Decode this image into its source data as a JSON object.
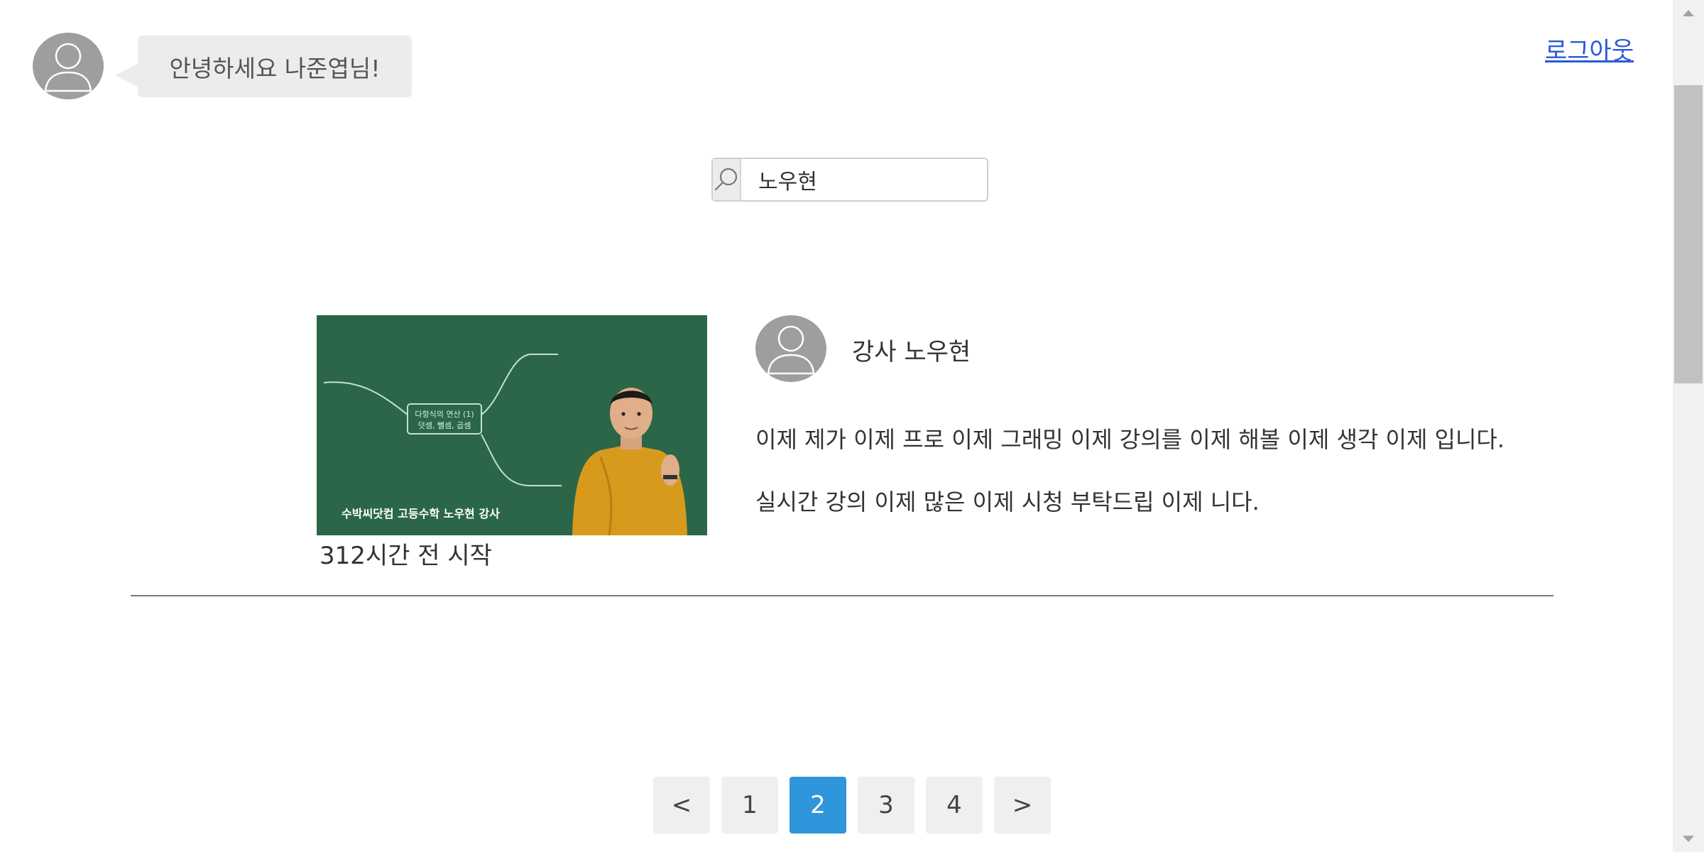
{
  "header": {
    "greeting": "안녕하세요 나준엽님!",
    "logout_label": "로그아웃"
  },
  "search": {
    "value": "노우현",
    "icon": "search-icon"
  },
  "lecture": {
    "thumbnail_text": {
      "center_box_line1": "다항식의 연산 (1)",
      "center_box_line2": "덧셈, 뺄셈, 곱셈",
      "bottom_caption": "수박씨닷컴 고등수학 노우현 강사"
    },
    "start_time": "312시간 전 시작",
    "instructor_name": "강사 노우현",
    "description_line1": "이제 제가 이제 프로 이제 그래밍 이제 강의를 이제 해볼 이제 생각 이제 입니다.",
    "description_line2": "실시간 강의 이제 많은 이제 시청 부탁드립 이제 니다."
  },
  "pagination": {
    "prev_label": "<",
    "next_label": ">",
    "pages": [
      "1",
      "2",
      "3",
      "4"
    ],
    "current_page": "2"
  },
  "colors": {
    "accent": "#2f95dc",
    "link": "#2a5ad7",
    "avatar_bg": "#9e9e9e",
    "chalkboard": "#2f6d4d"
  }
}
